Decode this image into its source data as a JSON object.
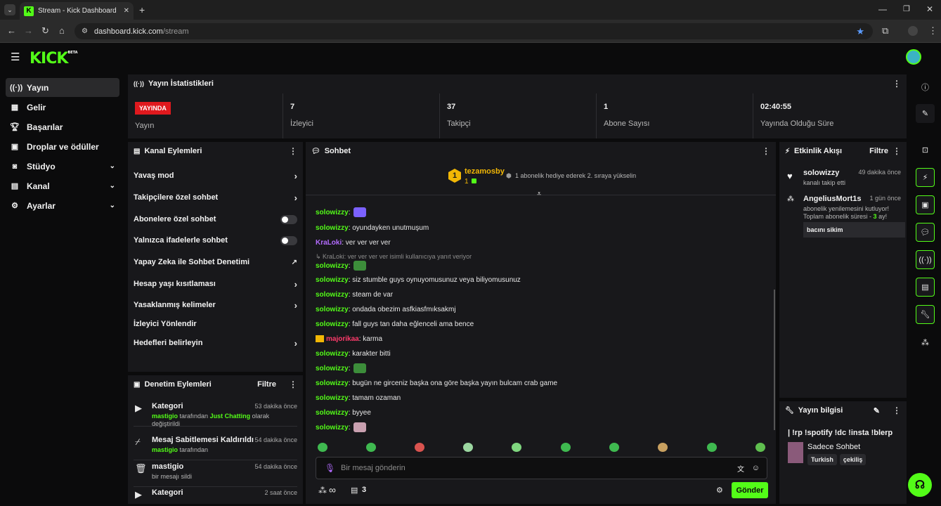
{
  "browser": {
    "tab_title": "Stream - Kick Dashboard",
    "url_host": "dashboard.kick.com",
    "url_path": "/stream"
  },
  "app": {
    "logo": "KICK",
    "logo_badge": "BETA"
  },
  "sidebar": {
    "items": [
      {
        "label": "Yayın",
        "icon": "broadcast-icon",
        "active": true
      },
      {
        "label": "Gelir",
        "icon": "revenue-icon"
      },
      {
        "label": "Başarılar",
        "icon": "trophy-icon"
      },
      {
        "label": "Droplar ve ödüller",
        "icon": "gift-icon"
      },
      {
        "label": "Stüdyo",
        "icon": "studio-icon",
        "expandable": true
      },
      {
        "label": "Kanal",
        "icon": "channel-icon",
        "expandable": true
      },
      {
        "label": "Ayarlar",
        "icon": "gear-icon",
        "expandable": true
      }
    ]
  },
  "stats": {
    "title": "Yayın İstatistikleri",
    "live_badge": "YAYINDA",
    "live_label": "Yayın",
    "viewers_value": "7",
    "viewers_label": "İzleyici",
    "followers_value": "37",
    "followers_label": "Takipçi",
    "subs_value": "1",
    "subs_label": "Abone Sayısı",
    "uptime_value": "02:40:55",
    "uptime_label": "Yayında Olduğu Süre"
  },
  "channel_actions": {
    "title": "Kanal Eylemleri",
    "items": [
      {
        "label": "Yavaş mod",
        "control": "arrow"
      },
      {
        "label": "Takipçilere özel sohbet",
        "control": "arrow"
      },
      {
        "label": "Abonelere özel sohbet",
        "control": "toggle",
        "on": false
      },
      {
        "label": "Yalnızca ifadelerle sohbet",
        "control": "toggle",
        "on": false
      },
      {
        "label": "Yapay Zeka ile Sohbet Denetimi",
        "control": "external"
      },
      {
        "label": "Hesap yaşı kısıtlaması",
        "control": "arrow"
      },
      {
        "label": "Yasaklanmış kelimeler",
        "control": "arrow"
      },
      {
        "label": "İzleyici Yönlendir",
        "control": "none"
      },
      {
        "label": "Hedefleri belirleyin",
        "control": "arrow"
      }
    ]
  },
  "moderation": {
    "title": "Denetim Eylemleri",
    "filter": "Filtre",
    "items": [
      {
        "title": "Kategori",
        "time": "53 dakika önce",
        "user": "mastigio",
        "pre": "tarafından",
        "cat": "Just Chatting",
        "post": "olarak değiştirildi"
      },
      {
        "title": "Mesaj Sabitlemesi Kaldırıldı",
        "time": "54 dakika önce",
        "user": "mastigio",
        "pre": "tarafından"
      },
      {
        "title": "mastigio",
        "time": "54 dakika önce",
        "sub": "bir mesajı sildi"
      },
      {
        "title": "Kategori",
        "time": "2 saat önce"
      }
    ]
  },
  "chat": {
    "title": "Sohbet",
    "pinned_user": "tezamosby",
    "pinned_count": "1",
    "pinned_rank": "1",
    "gift_text": "1 abonelik hediye ederek 2. sıraya yükselin",
    "messages": [
      {
        "user": "solowizzy",
        "text": "",
        "emote": "#7b61ff"
      },
      {
        "user": "solowizzy",
        "text": "oyundayken unutmuşum"
      },
      {
        "user": "KraLoki",
        "text": "ver ver ver ver",
        "color": "purple"
      },
      {
        "reply": "KraLoki: ver ver ver ver isimli kullanıcıya yanıt veriyor"
      },
      {
        "user": "solowizzy",
        "text": "",
        "emote": "#3c8d3a"
      },
      {
        "user": "solowizzy",
        "text": "siz stumble guys oynuyomusunuz veya biliyomusunuz"
      },
      {
        "user": "solowizzy",
        "text": "steam de var"
      },
      {
        "user": "solowizzy",
        "text": "ondada obezim asfkiasfmıksakmj"
      },
      {
        "user": "solowizzy",
        "text": "fall guys tan daha eğlenceli ama bence"
      },
      {
        "user": "majorikaa",
        "text": "karma",
        "color": "red"
      },
      {
        "user": "solowizzy",
        "text": "karakter bitti"
      },
      {
        "user": "solowizzy",
        "text": "",
        "emote": "#3c8d3a"
      },
      {
        "user": "solowizzy",
        "text": "bugün ne girceniz başka ona göre başka yayın bulcam crab game"
      },
      {
        "user": "solowizzy",
        "text": "tamam ozaman"
      },
      {
        "user": "solowizzy",
        "text": "byyee"
      },
      {
        "user": "solowizzy",
        "text": "",
        "emote": "#c9a0b0"
      }
    ],
    "input_placeholder": "Bir mesaj gönderin",
    "infinity": "∞",
    "box_count": "3",
    "send": "Gönder"
  },
  "activity": {
    "title": "Etkinlik Akışı",
    "filter": "Filtre",
    "items": [
      {
        "user": "solowizzy",
        "time": "49 dakika önce",
        "text": "kanalı takip etti"
      },
      {
        "user": "AngeliusMort1s",
        "time": "1 gün önce",
        "text": "abonelik yenilemesini kutluyor!",
        "text2_pre": "Toplam abonelik süresi - ",
        "months": "3",
        "text2_post": " ay!",
        "message": "bacını sikim"
      }
    ]
  },
  "stream_info": {
    "title": "Yayın bilgisi",
    "stream_title": "| !rp !spotify !dc !insta !blerp",
    "category": "Sadece Sohbet",
    "tags": [
      "Turkish",
      "çekiliş"
    ]
  },
  "colors": {
    "accent": "#53fc18",
    "live": "#e0191e",
    "panel": "#18181b"
  }
}
